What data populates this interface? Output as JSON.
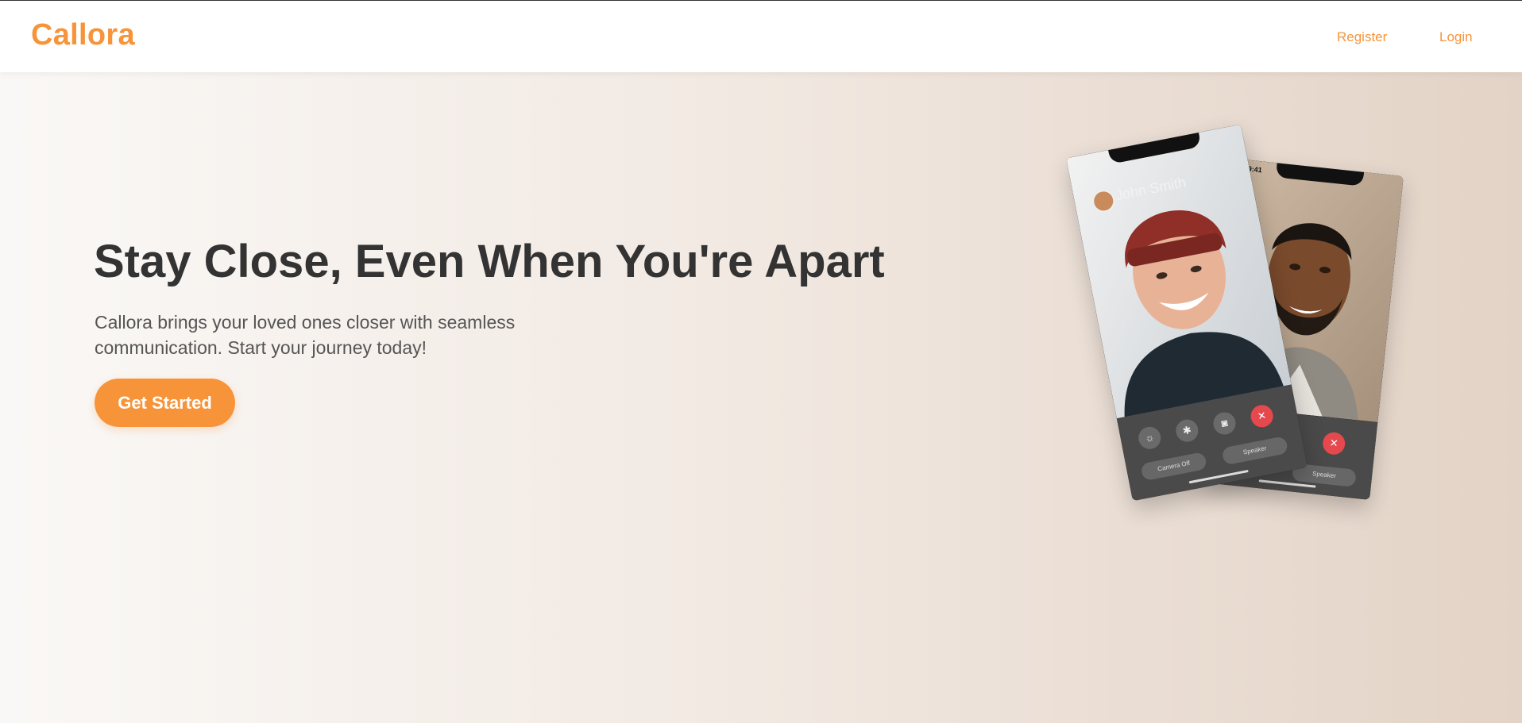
{
  "brand": {
    "name": "Callora",
    "color": "#f7943a"
  },
  "nav": {
    "register_label": "Register",
    "login_label": "Login"
  },
  "hero": {
    "title": "Stay Close, Even When You're Apart",
    "subtitle": "Callora brings your loved ones closer with seamless communication. Start your journey today!",
    "cta_label": "Get Started"
  },
  "phones": {
    "left": {
      "caller_name": "John Smith",
      "controls_icons": [
        "effects-icon",
        "mute-icon",
        "flip-icon",
        "end-call-icon"
      ],
      "camera_off_label": "Camera Off",
      "speaker_label": "Speaker"
    },
    "right": {
      "status_time": "9:41",
      "controls_icons": [
        "mute-icon",
        "flip-icon",
        "end-call-icon"
      ],
      "speaker_label": "Speaker"
    }
  },
  "colors": {
    "accent": "#f7943a",
    "heading": "#333333",
    "body_text": "#555555",
    "end_call": "#e5484d"
  }
}
